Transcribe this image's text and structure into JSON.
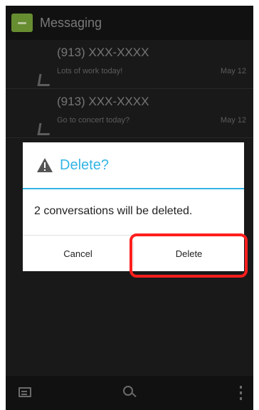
{
  "app": {
    "title": "Messaging"
  },
  "conversations": [
    {
      "name": "(913) XXX-XXXX",
      "snippet": "Lots of work today!",
      "date": "May 12"
    },
    {
      "name": "(913) XXX-XXXX",
      "snippet": "Go to concert today?",
      "date": "May 12"
    }
  ],
  "dialog": {
    "title": "Delete?",
    "message": "2 conversations will be deleted.",
    "cancel_label": "Cancel",
    "delete_label": "Delete",
    "icon": "warning-icon"
  },
  "bottom_bar": {
    "icons": [
      "compose-icon",
      "search-icon",
      "overflow-menu-icon"
    ]
  },
  "colors": {
    "accent": "#33b5e5",
    "highlight": "#ff1e1e",
    "app_icon": "#7aa63a"
  }
}
